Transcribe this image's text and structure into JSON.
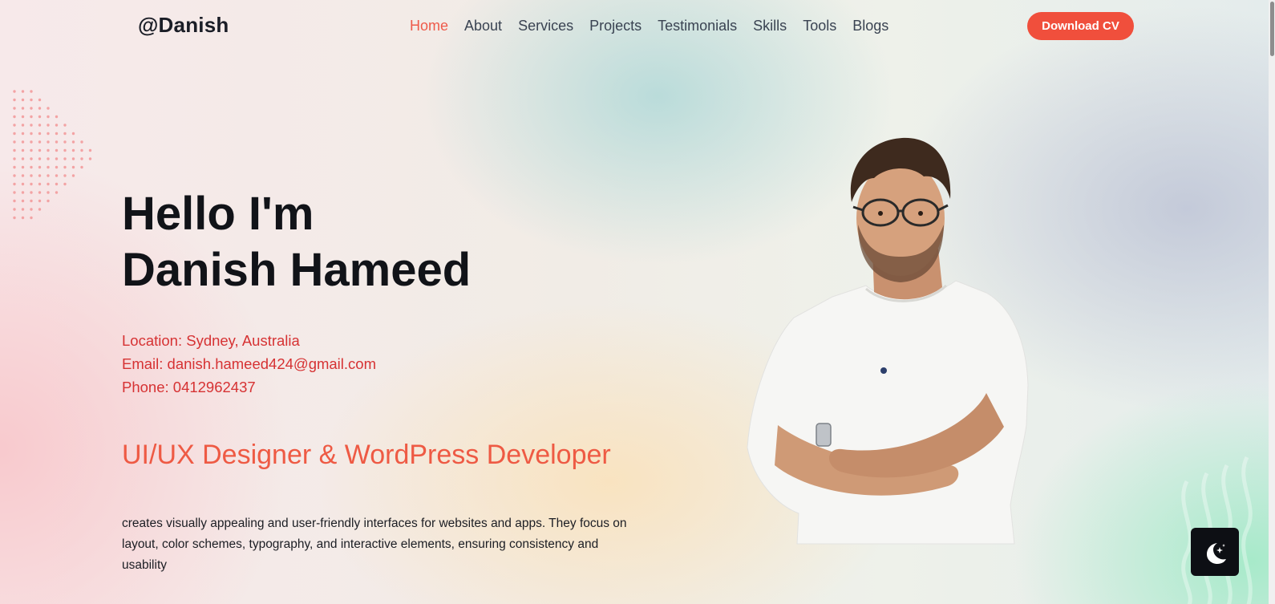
{
  "header": {
    "logo": "@Danish",
    "nav": [
      {
        "label": "Home",
        "active": true
      },
      {
        "label": "About",
        "active": false
      },
      {
        "label": "Services",
        "active": false
      },
      {
        "label": "Projects",
        "active": false
      },
      {
        "label": "Testimonials",
        "active": false
      },
      {
        "label": "Skills",
        "active": false
      },
      {
        "label": "Tools",
        "active": false
      },
      {
        "label": "Blogs",
        "active": false
      }
    ],
    "cta_label": "Download CV"
  },
  "hero": {
    "greeting": "Hello I'm",
    "name": "Danish Hameed",
    "location": "Location: Sydney, Australia",
    "email": "Email: danish.hameed424@gmail.com",
    "phone": "Phone: 0412962437",
    "role": "UI/UX Designer & WordPress Developer",
    "description": "creates visually appealing and user-friendly interfaces for websites and apps. They focus on layout, color schemes, typography, and interactive elements, ensuring consistency and usability"
  },
  "icons": {
    "theme_toggle": "moon-stars-icon",
    "portrait": "person-portrait"
  },
  "colors": {
    "accent": "#f04f3c",
    "nav_active": "#ee5a4a",
    "info_text": "#d63233",
    "role_text": "#ee5a44",
    "heading": "#111318",
    "toggle_bg": "#0d0f14"
  }
}
